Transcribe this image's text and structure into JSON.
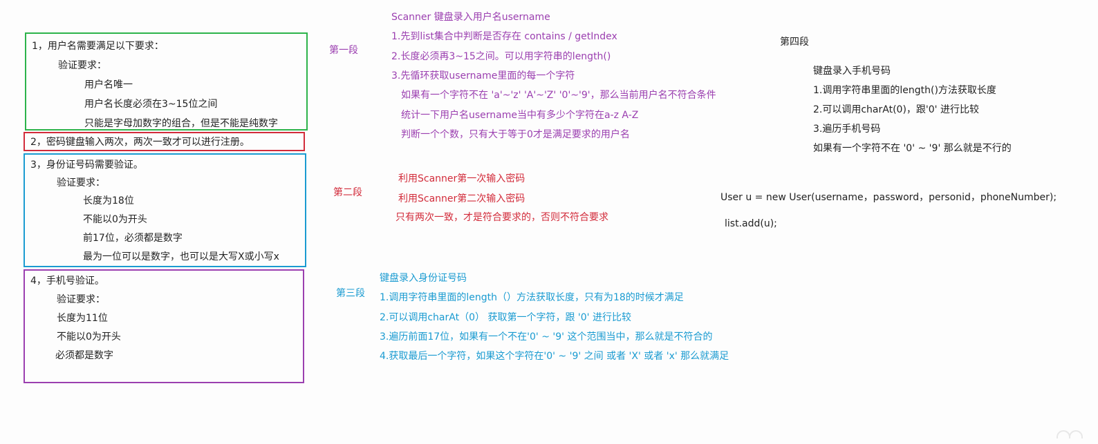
{
  "colors": {
    "green": "#2cb34a",
    "red": "#d22b3a",
    "blue": "#1a9bd1",
    "purple": "#9b3fb0"
  },
  "left": {
    "box1": [
      "1，用户名需要满足以下要求：",
      "验证要求：",
      "用户名唯一",
      "用户名长度必须在3~15位之间",
      "只能是字母加数字的组合，但是不能是纯数字"
    ],
    "box2": [
      "2，密码键盘输入两次，两次一致才可以进行注册。"
    ],
    "box3": [
      "3，身份证号码需要验证。",
      "验证要求：",
      "长度为18位",
      "不能以0为开头",
      "前17位，必须都是数字",
      "最为一位可以是数字，也可以是大写X或小写x"
    ],
    "box4": [
      "4，手机号验证。",
      "验证要求：",
      "长度为11位",
      "不能以0为开头",
      "必须都是数字"
    ]
  },
  "sections": {
    "s1": {
      "label": "第一段",
      "lines": [
        "Scanner 键盘录入用户名username",
        "1.先到list集合中判断是否存在  contains / getIndex",
        "2.长度必须再3~15之间。可以用字符串的length()",
        "3.先循环获取username里面的每一个字符",
        "如果有一个字符不在 'a'~'z'  'A'~'Z'  '0'~'9'，那么当前用户名不符合条件",
        "统计一下用户名username当中有多少个字符在a-z A-Z",
        "判断一个个数，只有大于等于0才是满足要求的用户名"
      ]
    },
    "s2": {
      "label": "第二段",
      "lines": [
        "利用Scanner第一次输入密码",
        "利用Scanner第二次输入密码",
        "只有两次一致，才是符合要求的，否则不符合要求"
      ]
    },
    "s3": {
      "label": "第三段",
      "lines": [
        "键盘录入身份证号码",
        "1.调用字符串里面的length（）方法获取长度，只有为18的时候才满足",
        "2.可以调用charAt（0） 获取第一个字符，跟 '0'  进行比较",
        "3.遍历前面17位，如果有一个不在'0' ~ '9' 这个范围当中，那么就是不符合的",
        "4.获取最后一个字符，如果这个字符在'0' ~ '9' 之间 或者 'X' 或者 'x' 那么就满足"
      ]
    },
    "s4": {
      "label": "第四段",
      "lines": [
        "键盘录入手机号码",
        "1.调用字符串里面的length()方法获取长度",
        "2.可以调用charAt(0)，跟'0' 进行比较",
        "3.遍历手机号码",
        "如果有一个字符不在 '0' ~ '9' 那么就是不行的"
      ]
    }
  },
  "code": {
    "line1": "User u = new User(username，password，personid，phoneNumber);",
    "line2": "list.add(u);"
  }
}
